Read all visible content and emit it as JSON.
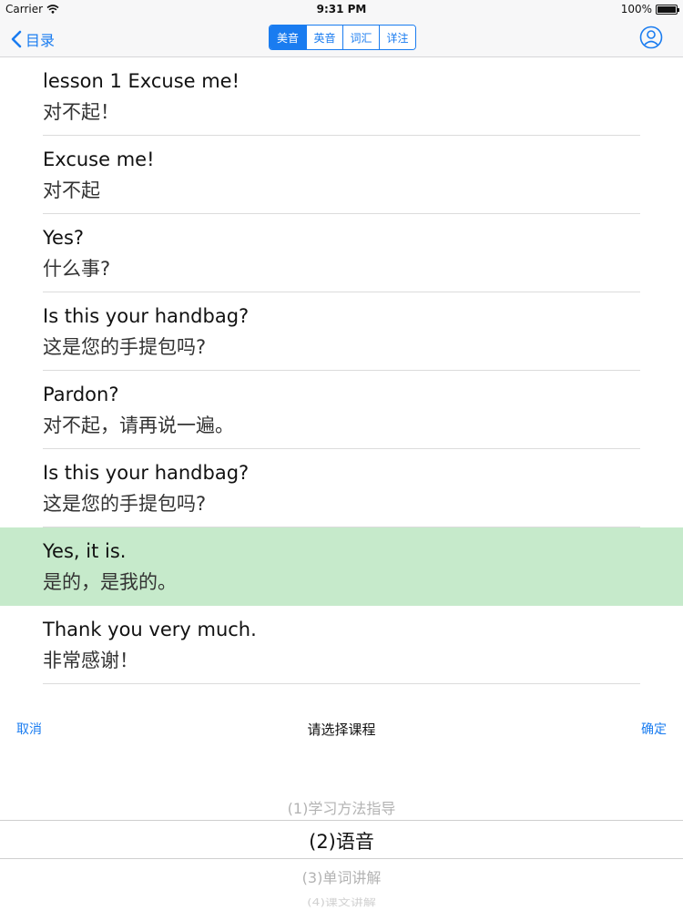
{
  "status_bar": {
    "carrier": "Carrier",
    "time": "9:31 PM",
    "battery": "100%",
    "wifi_icon": "wifi-icon",
    "battery_icon": "battery-icon"
  },
  "nav": {
    "back_label": "目录",
    "back_icon": "chevron-left-icon",
    "segments": [
      "美音",
      "英音",
      "词汇",
      "详注"
    ],
    "selected_segment": "美音",
    "user_icon": "user-icon",
    "accent_color": "#1a7cf0"
  },
  "sentences": [
    {
      "en": "lesson 1 Excuse me!",
      "zh": "对不起！"
    },
    {
      "en": "Excuse me!",
      "zh": "对不起"
    },
    {
      "en": "Yes?",
      "zh": "什么事?"
    },
    {
      "en": "Is this your handbag?",
      "zh": "这是您的手提包吗?"
    },
    {
      "en": "Pardon?",
      "zh": "对不起，请再说一遍。"
    },
    {
      "en": "Is this your handbag?",
      "zh": "这是您的手提包吗?"
    },
    {
      "en": "Yes, it is.",
      "zh": "是的，是我的。"
    },
    {
      "en": "Thank you very much.",
      "zh": "非常感谢！"
    }
  ],
  "highlighted_sentence": "Yes, it is.",
  "highlight_color": "#c6eacb",
  "picker": {
    "cancel_label": "取消",
    "title": "请选择课程",
    "confirm_label": "确定",
    "options": [
      "(1)学习方法指导",
      "(2)语音",
      "(3)单词讲解",
      "(4)课文讲解"
    ],
    "selected_option": "(2)语音"
  }
}
